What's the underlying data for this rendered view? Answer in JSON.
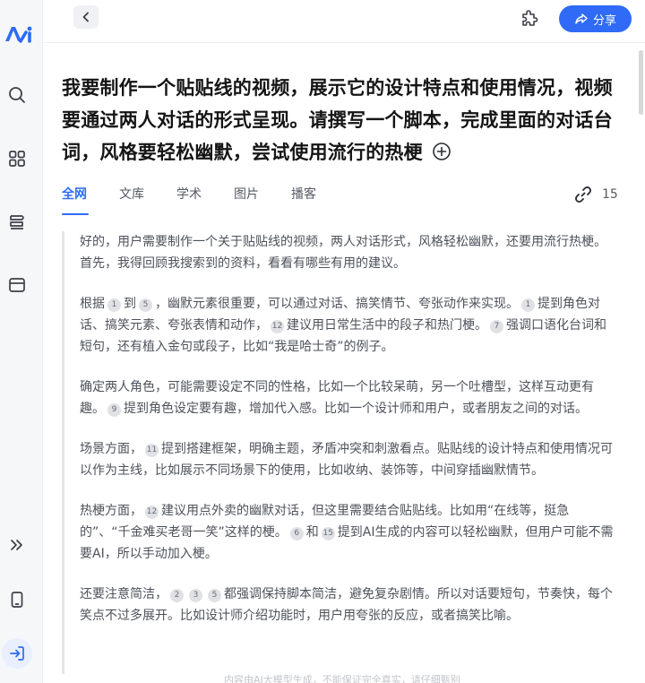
{
  "topbar": {
    "share_label": "分享"
  },
  "question": "我要制作一个贴贴线的视频，展示它的设计特点和使用情况，视频要通过两人对话的形式呈现。请撰写一个脚本，完成里面的对话台词，风格要轻松幽默，尝试使用流行的热梗",
  "tabs": [
    {
      "label": "全网"
    },
    {
      "label": "文库"
    },
    {
      "label": "学术"
    },
    {
      "label": "图片"
    },
    {
      "label": "播客"
    }
  ],
  "ref_count": "15",
  "reasoning": {
    "p1": {
      "t0": "好的，用户需要制作一个关于贴贴线的视频，两人对话形式，风格轻松幽默，还要用流行热梗。首先，我得回顾我搜索到的资料，看看有哪些有用的建议。"
    },
    "p2": {
      "t0": "根据",
      "c1": "1",
      "t1": "到",
      "c2": "5",
      "t2": "，幽默元素很重要，可以通过对话、搞笑情节、夸张动作来实现。",
      "c3": "1",
      "t3": "提到角色对话、搞笑元素、夸张表情和动作，",
      "c4": "12",
      "t4": "建议用日常生活中的段子和热门梗。",
      "c5": "7",
      "t5": "强调口语化台词和短句，还有植入金句或段子，比如“我是哈士奇”的例子。"
    },
    "p3": {
      "t0": "确定两人角色，可能需要设定不同的性格，比如一个比较呆萌，另一个吐槽型，这样互动更有趣。",
      "c1": "9",
      "t1": "提到角色设定要有趣，增加代入感。比如一个设计师和用户，或者朋友之间的对话。"
    },
    "p4": {
      "t0": "场景方面，",
      "c1": "11",
      "t1": "提到搭建框架，明确主题，矛盾冲突和刺激看点。贴贴线的设计特点和使用情况可以作为主线，比如展示不同场景下的使用，比如收纳、装饰等，中间穿插幽默情节。"
    },
    "p5": {
      "t0": "热梗方面，",
      "c1": "12",
      "t1": "建议用点外卖的幽默对话，但这里需要结合贴贴线。比如用“在线等，挺急的”、“千金难买老哥一笑”这样的梗。",
      "c2": "6",
      "t2": "和",
      "c3": "15",
      "t3": "提到AI生成的内容可以轻松幽默，但用户可能不需要AI，所以手动加入梗。"
    },
    "p6": {
      "t0": "还要注意简洁，",
      "c1": "2",
      "c2": "3",
      "c3": "5",
      "t1": "都强调保持脚本简洁，避免复杂剧情。所以对话要短句，节奏快，每个笑点不过多展开。比如设计师介绍功能时，用户用夸张的反应，或者搞笑比喻。"
    }
  },
  "footer": "内容由AI大模型生成，不能保证完全真实，请仔细甄别",
  "colors": {
    "accent": "#2f6bf6",
    "rail_bg": "#f6f7f9",
    "text_muted": "#4d525a"
  }
}
